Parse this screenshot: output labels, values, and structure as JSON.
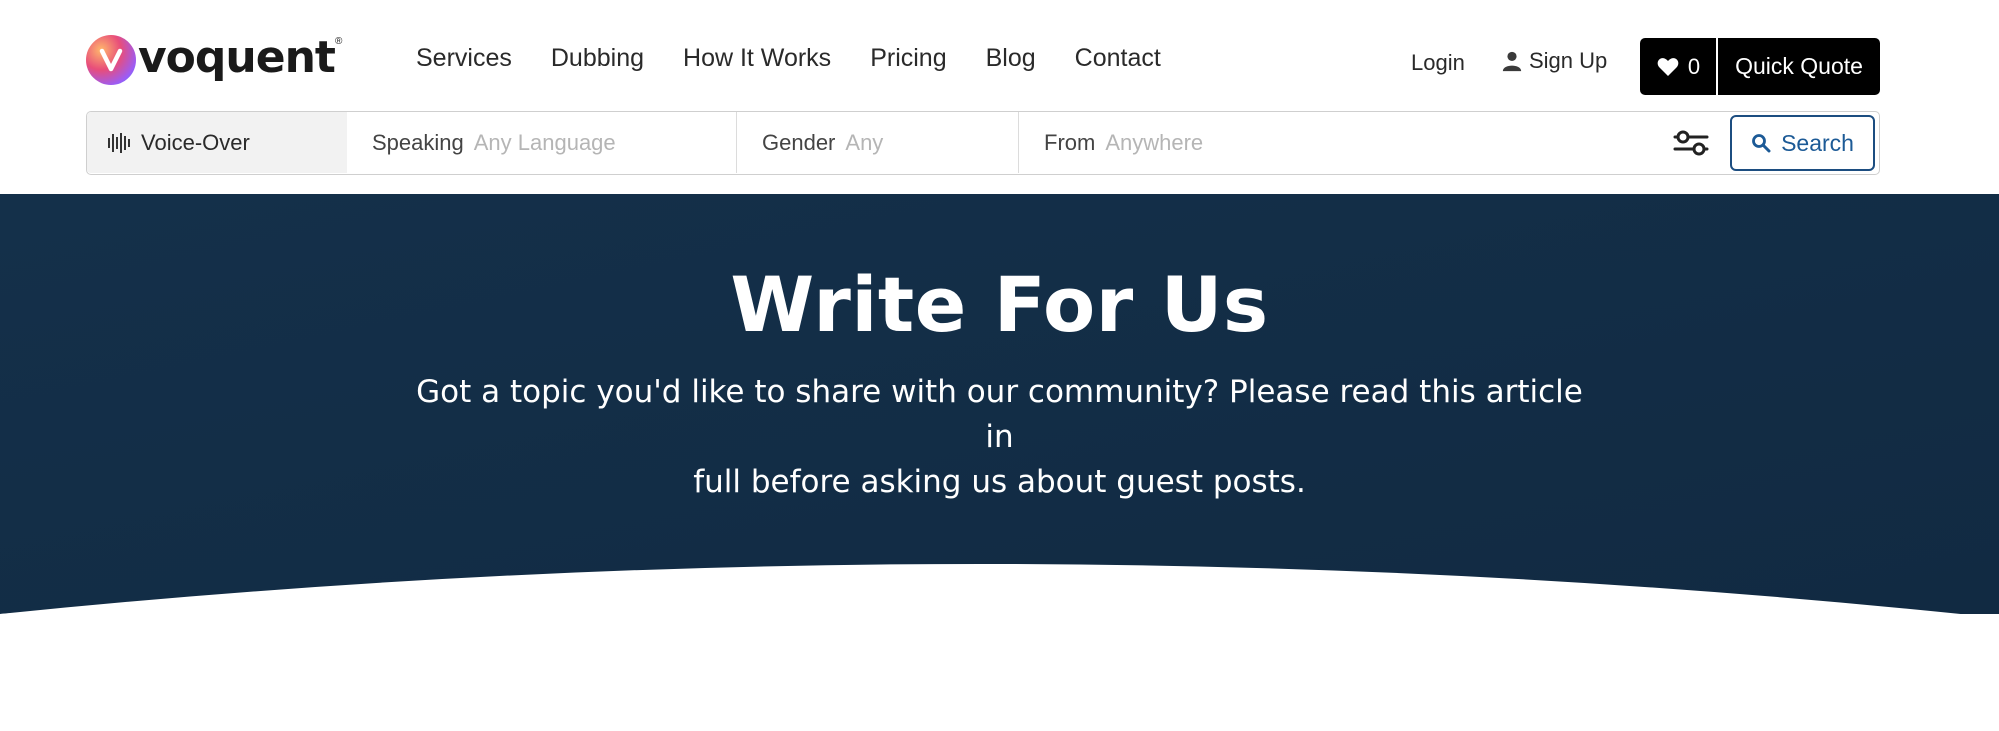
{
  "brand": {
    "name": "voquent",
    "registered_mark": "®",
    "gradient_colors": [
      "#ffb86c",
      "#e84d7a",
      "#9b5cf6",
      "#3b82f6"
    ]
  },
  "nav": {
    "items": [
      {
        "label": "Services"
      },
      {
        "label": "Dubbing"
      },
      {
        "label": "How It Works"
      },
      {
        "label": "Pricing"
      },
      {
        "label": "Blog"
      },
      {
        "label": "Contact"
      }
    ]
  },
  "account": {
    "login_label": "Login",
    "signup_label": "Sign Up",
    "signup_icon": "user-icon"
  },
  "actions": {
    "favorites_count": "0",
    "favorites_icon": "heart-icon",
    "quote_label": "Quick Quote"
  },
  "search": {
    "category_label": "Voice-Over",
    "category_icon": "soundwave-icon",
    "speaking_label": "Speaking",
    "speaking_value": "Any Language",
    "gender_label": "Gender",
    "gender_value": "Any",
    "from_label": "From",
    "from_value": "Anywhere",
    "filter_icon": "sliders-icon",
    "button_label": "Search",
    "button_icon": "search-icon",
    "accent_color": "#1c4d80"
  },
  "hero": {
    "title": "Write For Us",
    "subtitle_line1": "Got a topic you'd like to share with our community? Please read this article in",
    "subtitle_line2": "full before asking us about guest posts.",
    "background_color": "#132c44"
  }
}
